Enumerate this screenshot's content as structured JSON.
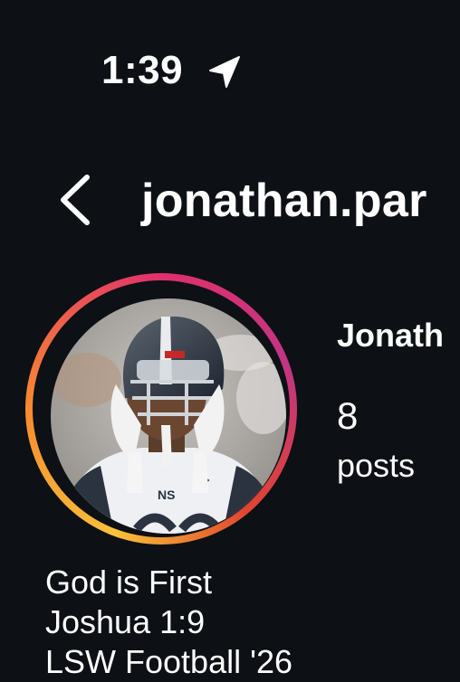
{
  "status_bar": {
    "time": "1:39",
    "location_icon": "location-arrow-icon"
  },
  "nav": {
    "back_icon": "chevron-left-icon",
    "username": "jonathan.par"
  },
  "profile": {
    "display_name": "Jonath",
    "posts": {
      "count": "8",
      "label": "posts"
    },
    "avatar": "football-player-photo",
    "ring_colors": [
      "#f9c13a",
      "#f78a2e",
      "#e1306c",
      "#c13584"
    ]
  },
  "bio": {
    "lines": [
      "God is First",
      "Joshua 1:9",
      "LSW Football '26"
    ]
  },
  "colors": {
    "background": "#0d1015",
    "text": "#ffffff"
  }
}
